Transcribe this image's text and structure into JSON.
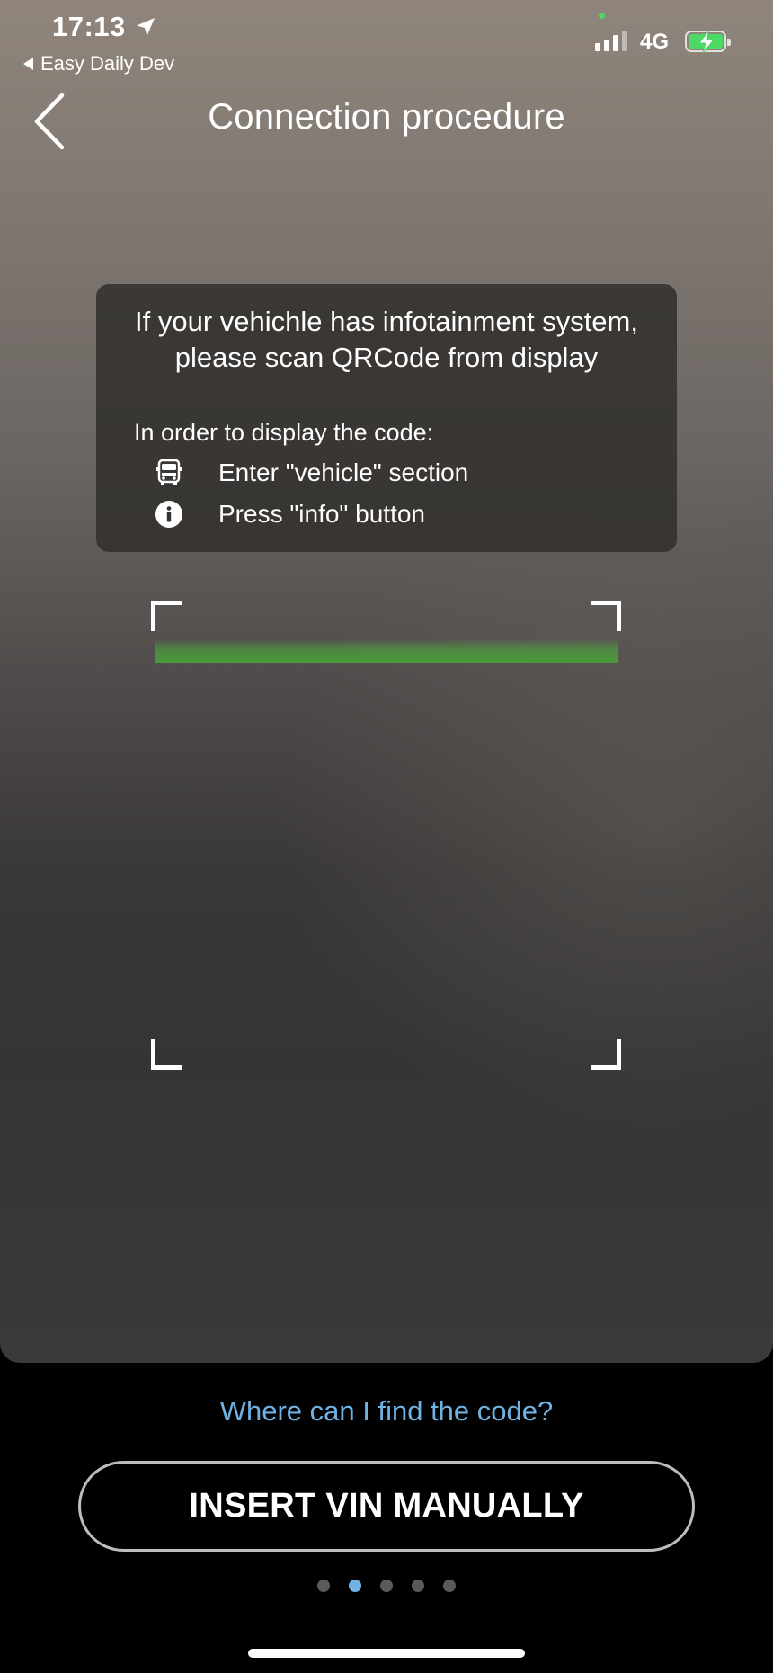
{
  "status_bar": {
    "time": "17:13",
    "back_app": "Easy Daily Dev",
    "network": "4G",
    "icons": [
      "location-arrow-icon",
      "signal-icon",
      "battery-charging-icon"
    ]
  },
  "header": {
    "title": "Connection procedure",
    "back_icon": "chevron-left-icon"
  },
  "info_card": {
    "headline": "If your vehichle has infotainment system, please scan QRCode from display",
    "subheading": "In order to display the code:",
    "steps": [
      {
        "icon": "truck-icon",
        "text": "Enter \"vehicle\" section"
      },
      {
        "icon": "info-icon",
        "text": "Press \"info\" button"
      }
    ]
  },
  "scanner": {
    "accent_color": "#4a9a3b"
  },
  "footer": {
    "help_link": "Where can I find the code?",
    "manual_button": "INSERT VIN MANUALLY",
    "pager": {
      "total": 5,
      "active_index": 1
    },
    "link_color": "#6fb2e3"
  }
}
